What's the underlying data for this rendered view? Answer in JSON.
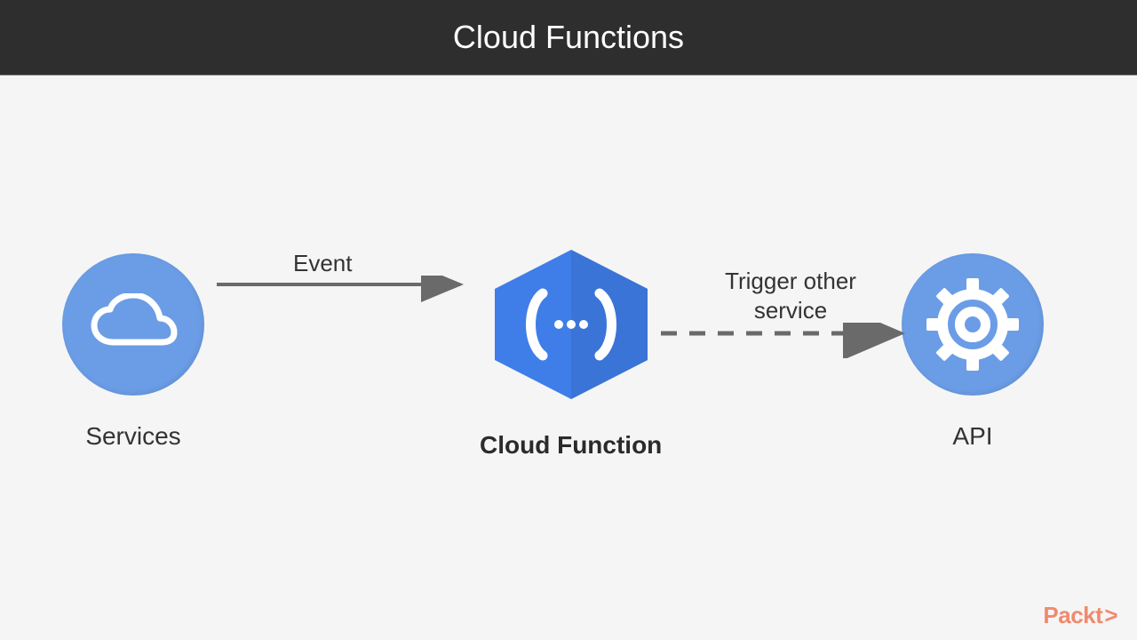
{
  "header": {
    "title": "Cloud Functions"
  },
  "nodes": {
    "services": {
      "label": "Services",
      "icon": "cloud-icon"
    },
    "cloud_function": {
      "label": "Cloud Function",
      "icon": "function-hex-icon"
    },
    "api": {
      "label": "API",
      "icon": "gear-icon"
    }
  },
  "arrows": {
    "event": {
      "label": "Event",
      "style": "solid"
    },
    "trigger": {
      "label": "Trigger other service",
      "style": "dashed"
    }
  },
  "watermark": {
    "text": "Packt",
    "suffix": ">"
  },
  "colors": {
    "header_bg": "#2e2e2e",
    "circle_fill": "#6b9de6",
    "hex_fill": "#3f7ee8",
    "accent_watermark": "#f08a6e",
    "arrow_stroke": "#6a6a6a"
  }
}
